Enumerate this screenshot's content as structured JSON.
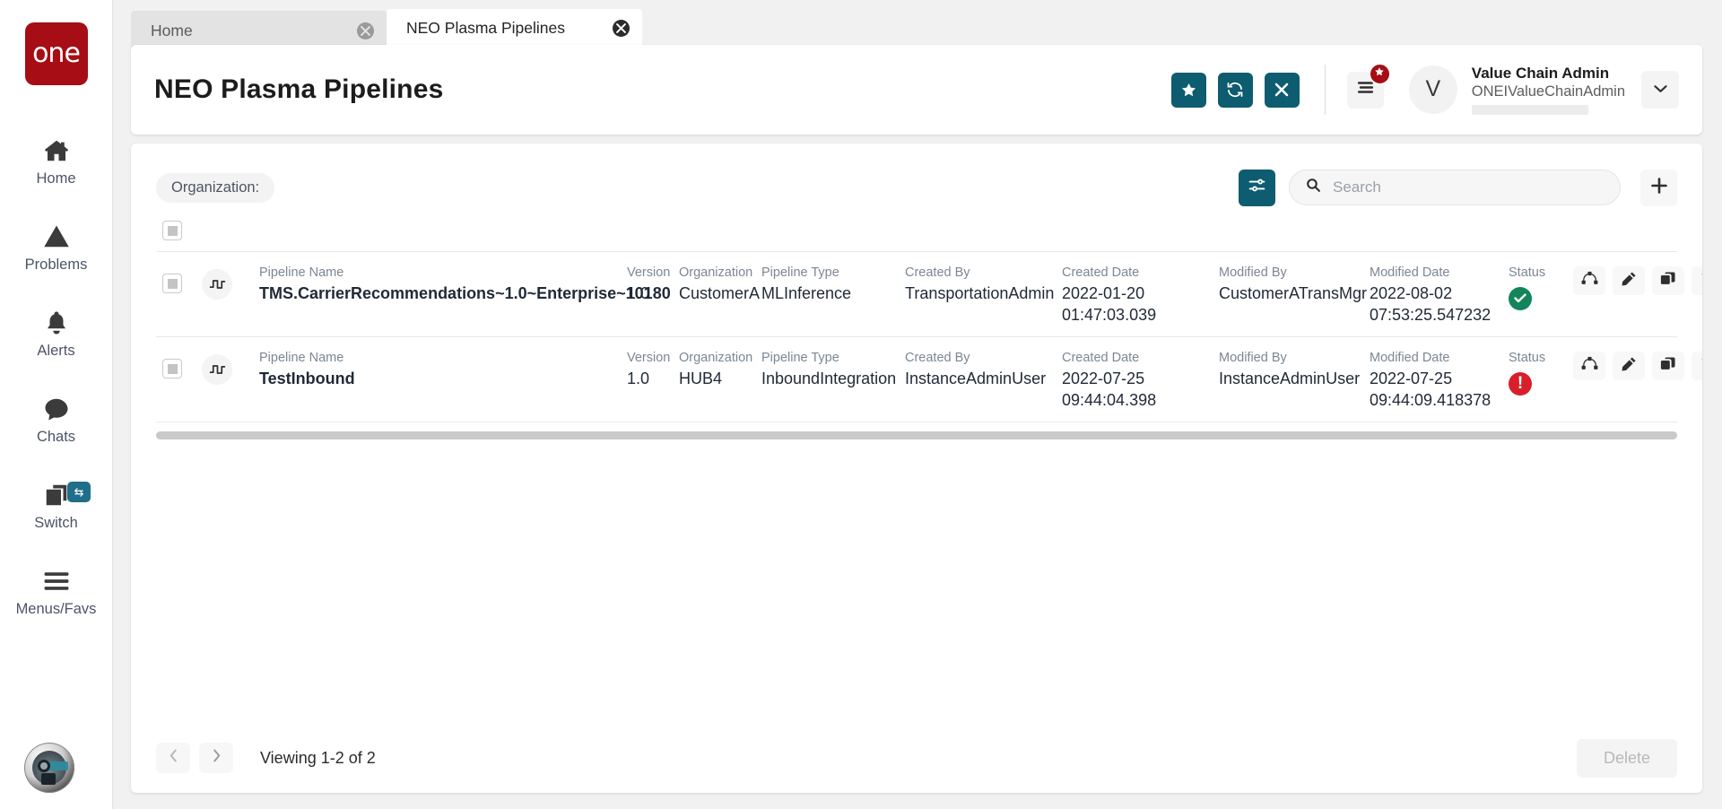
{
  "brand": {
    "logo_text": "one"
  },
  "sidebar": {
    "items": [
      {
        "label": "Home",
        "icon": "home-icon"
      },
      {
        "label": "Problems",
        "icon": "warning-triangle-icon"
      },
      {
        "label": "Alerts",
        "icon": "bell-icon"
      },
      {
        "label": "Chats",
        "icon": "chat-bubble-icon"
      },
      {
        "label": "Switch",
        "icon": "switch-windows-icon",
        "badge_icon": "swap-arrows-icon"
      },
      {
        "label": "Menus/Favs",
        "icon": "hamburger-icon"
      }
    ],
    "avatar_icon": "user-globe-avatar"
  },
  "tabs": [
    {
      "label": "Home",
      "active": false,
      "close_icon": "close-circle-icon"
    },
    {
      "label": "NEO Plasma Pipelines",
      "active": true,
      "close_icon": "close-circle-icon"
    }
  ],
  "header": {
    "title": "NEO Plasma Pipelines",
    "actions": [
      {
        "name": "favorite-button",
        "icon": "star-icon"
      },
      {
        "name": "refresh-button",
        "icon": "refresh-icon"
      },
      {
        "name": "close-button",
        "icon": "x-icon"
      }
    ],
    "menu_button_icon": "menu-lines-icon",
    "menu_badge_icon": "star-icon",
    "user": {
      "initial": "V",
      "name": "Value Chain Admin",
      "login": "ONEIValueChainAdmin",
      "caret_icon": "chevron-down-icon"
    }
  },
  "toolbar": {
    "org_filter_label": "Organization:",
    "filter_button_icon": "sliders-icon",
    "search": {
      "placeholder": "Search",
      "value": "",
      "icon": "search-icon"
    },
    "add_button_icon": "plus-icon"
  },
  "table": {
    "select_all_checked": true,
    "columns": {
      "name": "Pipeline Name",
      "version": "Version",
      "organization": "Organization",
      "type": "Pipeline Type",
      "created_by": "Created By",
      "created_date": "Created Date",
      "modified_by": "Modified By",
      "modified_date": "Modified Date",
      "status": "Status"
    },
    "row_actions": [
      {
        "name": "view-graph-button",
        "icon": "node-graph-icon"
      },
      {
        "name": "edit-button",
        "icon": "pencil-icon"
      },
      {
        "name": "copy-button",
        "icon": "copy-icon"
      },
      {
        "name": "delete-row-button",
        "icon": "trash-icon"
      }
    ],
    "rows": [
      {
        "type_icon": "pipeline-signal-icon",
        "name": "TMS.CarrierRecommendations~1.0~Enterprise~10180",
        "version": "1.0",
        "organization": "CustomerA",
        "pipeline_type": "MLInference",
        "created_by": "TransportationAdmin",
        "created_date_line1": "2022-01-20",
        "created_date_line2": "01:47:03.039",
        "modified_by": "CustomerATransMgr",
        "modified_date_line1": "2022-08-02",
        "modified_date_line2": "07:53:25.547232",
        "status": "ok"
      },
      {
        "type_icon": "pipeline-signal-icon",
        "name": "TestInbound",
        "version": "1.0",
        "organization": "HUB4",
        "pipeline_type": "InboundIntegration",
        "created_by": "InstanceAdminUser",
        "created_date_line1": "2022-07-25",
        "created_date_line2": "09:44:04.398",
        "modified_by": "InstanceAdminUser",
        "modified_date_line1": "2022-07-25",
        "modified_date_line2": "09:44:09.418378",
        "status": "error"
      }
    ]
  },
  "footer": {
    "prev_icon": "chevron-left-icon",
    "next_icon": "chevron-right-icon",
    "viewing_text": "Viewing 1-2 of 2",
    "delete_label": "Delete"
  },
  "colors": {
    "brand_red": "#a60d15",
    "accent_teal": "#0d5c70",
    "tab_underline": "#1f6e8c",
    "status_ok": "#12855a",
    "status_error": "#d81f2a",
    "page_bg": "#f1f1f1"
  }
}
